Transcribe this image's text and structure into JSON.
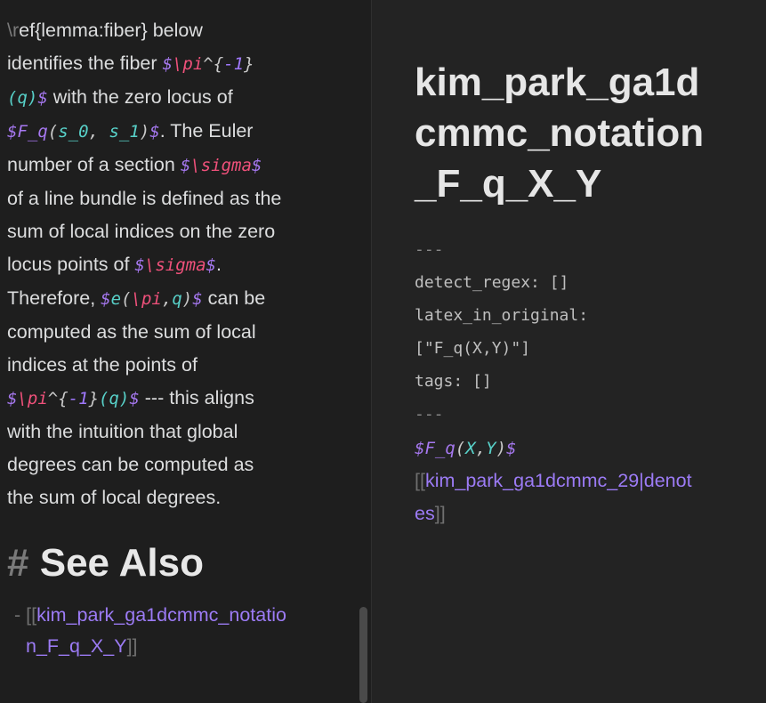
{
  "left_pane": {
    "paragraph": {
      "l1a": "\\r",
      "l1b": "ef{lemma:fiber} below",
      "l2a": "identifies the fiber ",
      "l2_d1": "$",
      "l2_cmd": "\\pi",
      "l2_sup": "^{",
      "l2_num": "-1",
      "l2_close": "}",
      "l3_open": "(q)",
      "l3_d": "$",
      "l3_text": " with the zero locus of",
      "l4_d1": "$",
      "l4_F": "F_q",
      "l4_p1": "(",
      "l4_s0": "s_0",
      "l4_comma": ", ",
      "l4_s1": "s_1",
      "l4_p2": ")",
      "l4_d2": "$",
      "l4_text": ". The Euler",
      "l5_text": "number of a section ",
      "l5_d1": "$",
      "l5_cmd": "\\sigma",
      "l5_d2": "$",
      "l6": "of a line bundle is defined as the",
      "l7": "sum of local indices on the zero",
      "l8_text": "locus points of ",
      "l8_d1": "$",
      "l8_cmd": "\\sigma",
      "l8_d2": "$",
      "l8_end": ".",
      "l9_text": "Therefore, ",
      "l9_d1": "$",
      "l9_e": "e",
      "l9_p1": "(",
      "l9_cmd": "\\pi",
      "l9_comma": ",",
      "l9_q": "q",
      "l9_p2": ")",
      "l9_d2": "$",
      "l9_end": " can be",
      "l10": "computed as the sum of local",
      "l11": "indices at the points of",
      "l12_d1": "$",
      "l12_cmd": "\\pi",
      "l12_sup": "^{",
      "l12_num": "-1",
      "l12_close": "}",
      "l12_q": "(q)",
      "l12_d2": "$",
      "l12_end": " --- this aligns",
      "l13": "with the intuition that global",
      "l14": "degrees can be computed as",
      "l15": "the sum of local degrees."
    },
    "see_also": {
      "hash": "#",
      "title": "See Also"
    },
    "link": {
      "dash": "- ",
      "open": "[[",
      "text1": "kim_park_ga1dcmmc_notatio",
      "text2": "n_F_q_X_Y",
      "close": "]]"
    }
  },
  "right_pane": {
    "title_lines": [
      "kim_park_ga1d",
      "cmmc_notation",
      "_F_q_X_Y"
    ],
    "frontmatter": {
      "dash1": "---",
      "line1": "detect_regex: []",
      "line2": "latex_in_original:",
      "line3": "[\"F_q(X,Y)\"]",
      "line4": "tags: []",
      "dash2": "---"
    },
    "math": {
      "d1": "$",
      "F": "F_q",
      "p1": "(",
      "X": "X",
      "comma": ",",
      "Y": "Y",
      "p2": ")",
      "d2": "$"
    },
    "link": {
      "open": "[[",
      "text1": "kim_park_ga1dcmmc_29|denot",
      "text2": "es",
      "close": "]]"
    }
  },
  "colors": {
    "background": "#1e1e1e",
    "link": "#9c7bf5",
    "math_dollar": "#a678f0",
    "math_command": "#f0517b",
    "math_variable": "#58d1c9"
  }
}
